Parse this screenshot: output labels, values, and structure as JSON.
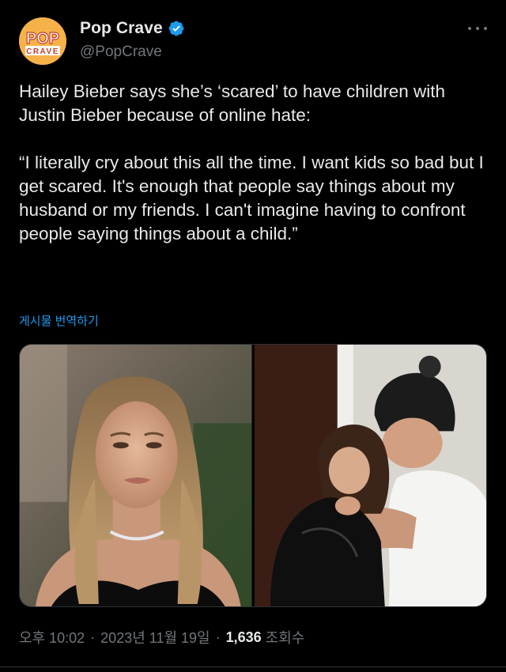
{
  "author": {
    "display_name": "Pop Crave",
    "handle": "@PopCrave",
    "verified": true,
    "avatar_text_top": "POP",
    "avatar_text_bottom": "CRAVE"
  },
  "tweet": {
    "text": "Hailey Bieber says she’s ‘scared’ to have children with Justin Bieber because of online hate:\n\n“I literally cry about this all the time. I want kids so bad but I get scared. It's enough that people say things about my husband or my friends. I can't imagine having to confront people saying things about a child.”",
    "translate_label": "게시물 번역하기"
  },
  "media": {
    "photos": [
      {
        "name": "photo-hailey-portrait"
      },
      {
        "name": "photo-couple-embrace"
      }
    ]
  },
  "meta": {
    "time": "오후 10:02",
    "date": "2023년 11월 19일",
    "separator": "·",
    "views_count": "1,636",
    "views_label": "조회수"
  },
  "colors": {
    "background": "#000000",
    "text": "#e7e9ea",
    "secondary": "#71767b",
    "link": "#1d9bf0",
    "verified": "#1d9bf0",
    "avatar_bg": "#f2a53a"
  }
}
